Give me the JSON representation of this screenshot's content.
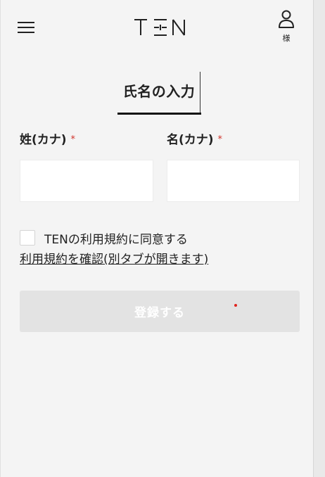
{
  "header": {
    "logo_text": "TEN",
    "user_label": "様"
  },
  "page": {
    "title": "氏名の入力"
  },
  "form": {
    "last_name": {
      "label": "姓(カナ)",
      "required_mark": "*",
      "value": ""
    },
    "first_name": {
      "label": "名(カナ)",
      "required_mark": "*",
      "value": ""
    },
    "agree_text": "TENの利用規約に同意する",
    "agree_checked": false,
    "terms_link": "利用規約を確認(別タブが開きます)",
    "submit_label": "登録する"
  },
  "colors": {
    "background": "#f4f4f4",
    "text": "#222222",
    "required": "#d0322a",
    "submit_disabled_bg": "#e3e3e3",
    "submit_text": "#ffffff"
  }
}
